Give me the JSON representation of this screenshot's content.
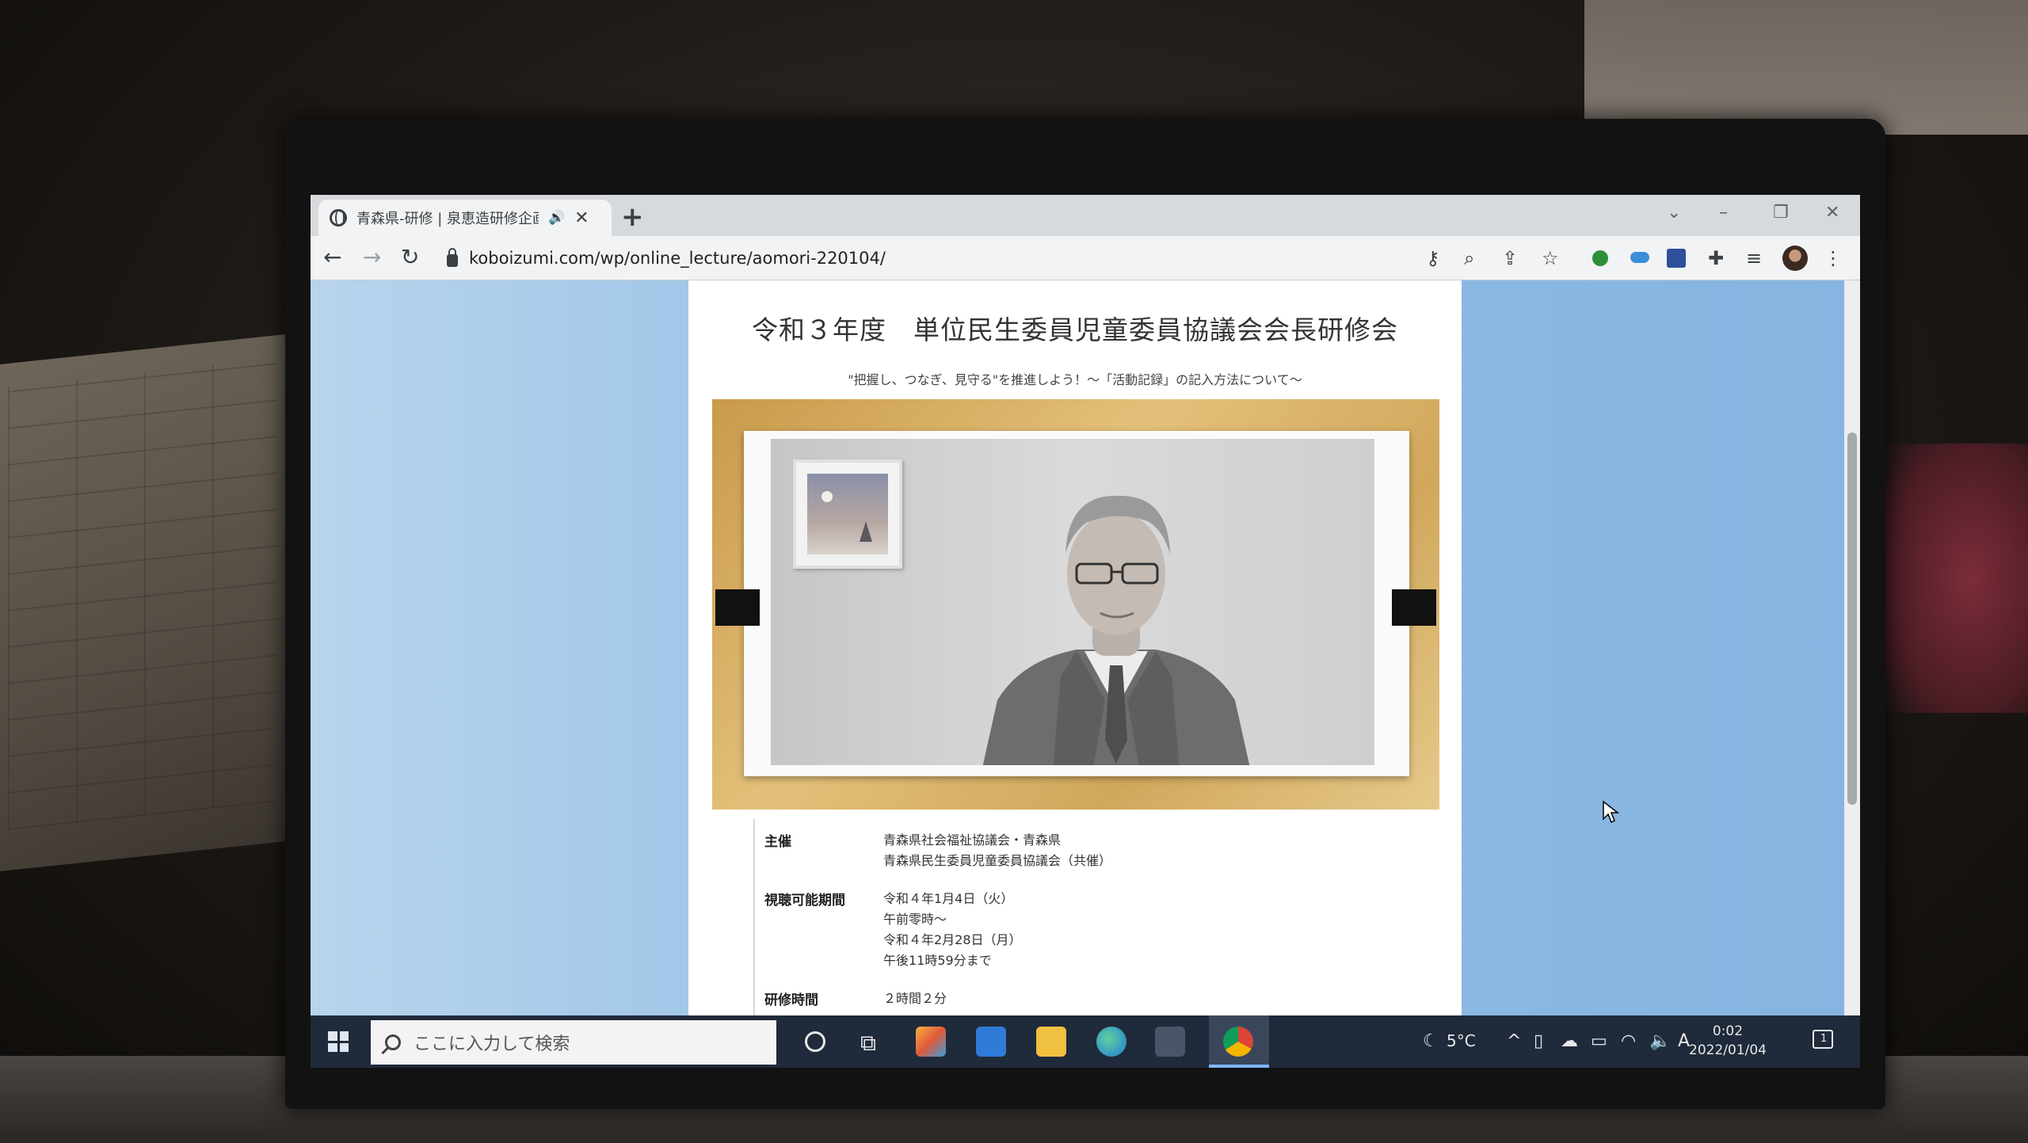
{
  "browser": {
    "tab_title": "青森県-研修 | 泉恵造研修企画",
    "url": "koboizumi.com/wp/online_lecture/aomori-220104/"
  },
  "page": {
    "title": "令和３年度　単位民生委員児童委員協議会会長研修会",
    "subtitle": "\"把握し、つなぎ、見守る\"を推進しよう！～「活動記録」の記入方法について～",
    "info": [
      {
        "label": "主催",
        "values": [
          "青森県社会福祉協議会・青森県",
          "青森県民生委員児童委員協議会（共催）"
        ]
      },
      {
        "label": "視聴可能期間",
        "values": [
          "令和４年1月4日（火）",
          "午前零時～",
          "令和４年2月28日（月）",
          "午後11時59分まで"
        ]
      },
      {
        "label": "研修時間",
        "values": [
          "２時間２分"
        ]
      }
    ]
  },
  "taskbar": {
    "search_placeholder": "ここに入力して検索",
    "weather": "5°C",
    "ime": "A",
    "time": "0:02",
    "date": "2022/01/04",
    "notification_count": "1"
  },
  "colors": {
    "page_background": "#8fbde6",
    "taskbar": "#1f2a3a",
    "video_frame": "#d9b468"
  }
}
